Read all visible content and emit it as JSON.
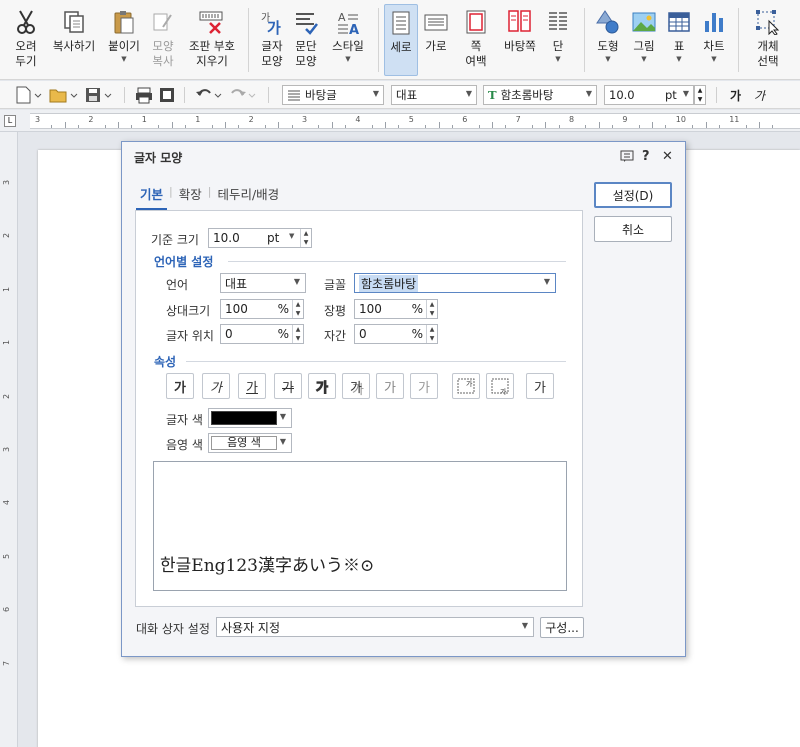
{
  "ribbon": {
    "cut": [
      "오려",
      "두기"
    ],
    "copy": "복사하기",
    "paste": "붙이기",
    "format_copy": [
      "모양",
      "복사"
    ],
    "clear_code": [
      "조판 부호",
      "지우기"
    ],
    "char_shape": [
      "글자",
      "모양"
    ],
    "para_shape": [
      "문단",
      "모양"
    ],
    "style": "스타일",
    "portrait": "세로",
    "landscape": "가로",
    "margins": [
      "쪽",
      "여백"
    ],
    "master_page": "바탕쪽",
    "columns": "단",
    "shapes": "도형",
    "picture": "그림",
    "table": "표",
    "chart": "차트",
    "object_select": [
      "개체",
      "선택"
    ]
  },
  "toolbar": {
    "style_combo": "바탕글",
    "lang_combo": "대표",
    "font_combo": "함초롬바탕",
    "size_value": "10.0",
    "size_unit": "pt",
    "bold_glyph": "가",
    "italic_glyph": "가"
  },
  "ruler": {
    "marks": [
      "3",
      "2",
      "1",
      "1",
      "2",
      "3",
      "4",
      "5",
      "6",
      "7",
      "8",
      "9",
      "10",
      "11"
    ],
    "vmarks": [
      "3",
      "2",
      "1",
      "1",
      "2",
      "3",
      "4",
      "5",
      "6",
      "7"
    ]
  },
  "dialog": {
    "title": "글자 모양",
    "tabs": [
      "기본",
      "확장",
      "테두리/배경"
    ],
    "base_size_label": "기준 크기",
    "base_size_value": "10.0",
    "base_size_unit": "pt",
    "lang_section": "언어별 설정",
    "lang_label": "언어",
    "lang_value": "대표",
    "font_label": "글꼴",
    "font_value": "함초롬바탕",
    "rel_size_label": "상대크기",
    "rel_size_value": "100",
    "ratio_label": "장평",
    "ratio_value": "100",
    "pos_label": "글자 위치",
    "pos_value": "0",
    "spacing_label": "자간",
    "spacing_value": "0",
    "percent": "%",
    "attr_section": "속성",
    "attr_glyph": "가",
    "text_color_label": "글자 색",
    "text_color": "#000000",
    "shade_color_label": "음영 색",
    "shade_color_value": "음영 색",
    "preview_text": "한글Eng123漢字あいう※⊙",
    "ok_button": "설정(D)",
    "cancel_button": "취소",
    "dlg_settings_label": "대화 상자 설정",
    "dlg_settings_value": "사용자 지정",
    "configure_button": "구성..."
  }
}
